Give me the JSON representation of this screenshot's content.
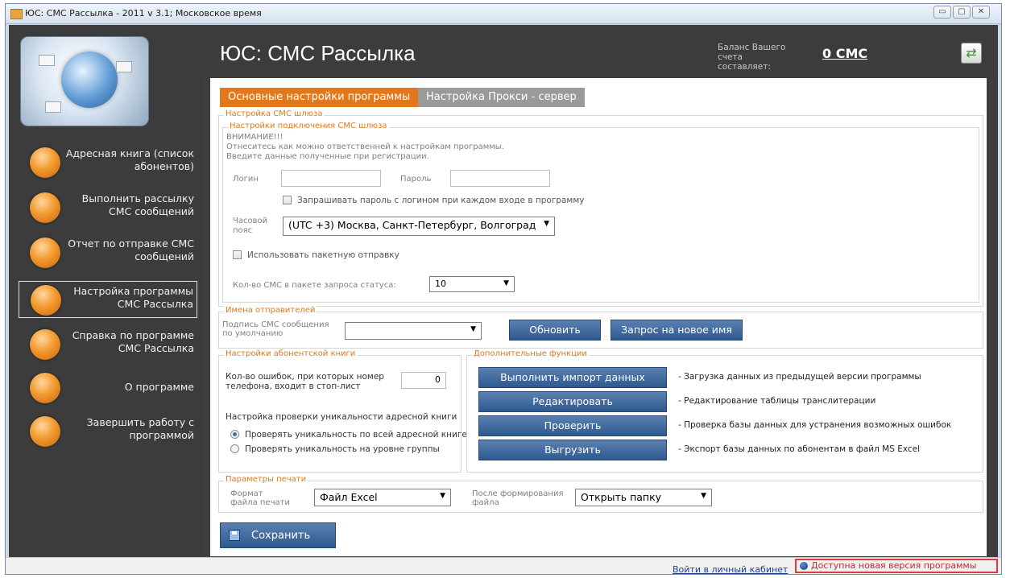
{
  "window": {
    "title": "ЮС: СМС Рассылка - 2011 v 3.1; Московское время",
    "controls": {
      "minimize": "▭",
      "maximize": "▢",
      "close": "✕"
    }
  },
  "header": {
    "app_title": "ЮС: СМС Рассылка",
    "balance_caption": "Баланс Вашего счета составляет:",
    "balance_value": "0 СМС"
  },
  "sidebar": {
    "items": [
      {
        "label": "Адресная книга (список абонентов)"
      },
      {
        "label": "Выполнить рассылку СМС сообщений"
      },
      {
        "label": "Отчет по отправке СМС сообщений"
      },
      {
        "label": "Настройка программы СМС Рассылка"
      },
      {
        "label": "Справка по программе СМС Рассылка"
      },
      {
        "label": "О программе"
      },
      {
        "label": "Завершить работу с программой"
      }
    ],
    "active_index": 3
  },
  "tabs": [
    {
      "label": "Основные настройки программы"
    },
    {
      "label": "Настройка Прокси - сервер"
    }
  ],
  "gateway": {
    "legend": "Настройка СМС шлюза",
    "conn_legend": "Настройки подключения СМС шлюза",
    "warning_title": "ВНИМАНИЕ!!!",
    "warning_line1": "Отнеситесь как можно ответственней к настройкам программы.",
    "warning_line2": "Введите данные полученные при регистрации.",
    "login_label": "Логин",
    "login_value": "",
    "password_label": "Пароль",
    "password_value": "",
    "ask_password_label": "Запрашивать пароль с логином при каждом входе в программу",
    "timezone_label_1": "Часовой",
    "timezone_label_2": "пояс",
    "timezone_value": "(UTC +3) Москва, Санкт-Петербург, Волгоград",
    "packet_label": "Использовать пакетную отправку",
    "status_count_label": "Кол-во СМС в пакете запроса статуса:",
    "status_count_value": "10"
  },
  "senders": {
    "legend": "Имена отправителей",
    "signature_label_1": "Подпись СМС сообщения",
    "signature_label_2": "по умолчанию",
    "signature_value": "",
    "refresh_button": "Обновить",
    "request_button": "Запрос на новое имя"
  },
  "abonent": {
    "legend": "Настройки абонентской книги",
    "errors_label_1": "Кол-во ошибок, при которых номер",
    "errors_label_2": "телефона, входит в стоп-лист",
    "errors_value": "0",
    "unique_title": "Настройка проверки уникальности адресной книги",
    "radio_all": "Проверять уникальность по всей адресной книге",
    "radio_group": "Проверять уникальность на уровне группы"
  },
  "extra": {
    "legend": "Дополнительные функции",
    "rows": [
      {
        "button": "Выполнить импорт данных",
        "desc": "- Загрузка данных из предыдущей версии программы"
      },
      {
        "button": "Редактировать",
        "desc": "- Редактирование таблицы транслитерации"
      },
      {
        "button": "Проверить",
        "desc": "- Проверка базы данных для устранения возможных ошибок"
      },
      {
        "button": "Выгрузить",
        "desc": "- Экспорт базы данных по абонентам в файл MS Excel"
      }
    ]
  },
  "print": {
    "legend": "Параметры печати",
    "format_label_1": "Формат",
    "format_label_2": "файла печати",
    "format_value": "Файл Excel",
    "after_label_1": "После формирования",
    "after_label_2": "файла",
    "after_value": "Открыть папку"
  },
  "save_button": "Сохранить",
  "statusbar": {
    "account_link": "Войти в личный кабинет",
    "new_version": "Доступна новая версия программы"
  },
  "colors": {
    "accent": "#e2781a",
    "button": "#3a6499",
    "sidebar_bg": "#3c3c3c",
    "highlight_border": "#e23b3b"
  }
}
